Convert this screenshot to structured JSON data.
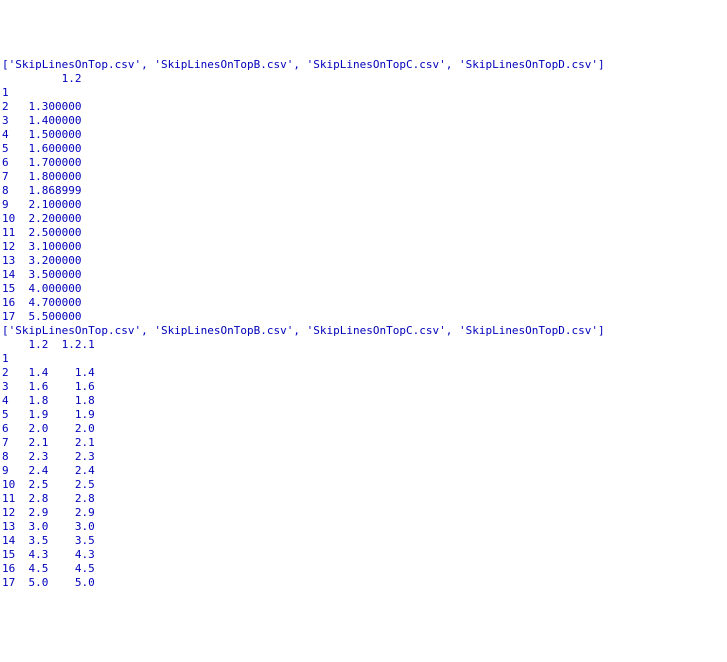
{
  "blocks": [
    {
      "file_list": "['SkipLinesOnTop.csv', 'SkipLinesOnTopB.csv', 'SkipLinesOnTopC.csv', 'SkipLinesOnTopD.csv']",
      "header": "         1.2",
      "index_only_first": "1",
      "rows": [
        {
          "i": "2",
          "cells": [
            "1.300000"
          ]
        },
        {
          "i": "3",
          "cells": [
            "1.400000"
          ]
        },
        {
          "i": "4",
          "cells": [
            "1.500000"
          ]
        },
        {
          "i": "5",
          "cells": [
            "1.600000"
          ]
        },
        {
          "i": "6",
          "cells": [
            "1.700000"
          ]
        },
        {
          "i": "7",
          "cells": [
            "1.800000"
          ]
        },
        {
          "i": "8",
          "cells": [
            "1.868999"
          ]
        },
        {
          "i": "9",
          "cells": [
            "2.100000"
          ]
        },
        {
          "i": "10",
          "cells": [
            "2.200000"
          ]
        },
        {
          "i": "11",
          "cells": [
            "2.500000"
          ]
        },
        {
          "i": "12",
          "cells": [
            "3.100000"
          ]
        },
        {
          "i": "13",
          "cells": [
            "3.200000"
          ]
        },
        {
          "i": "14",
          "cells": [
            "3.500000"
          ]
        },
        {
          "i": "15",
          "cells": [
            "4.000000"
          ]
        },
        {
          "i": "16",
          "cells": [
            "4.700000"
          ]
        },
        {
          "i": "17",
          "cells": [
            "5.500000"
          ]
        }
      ]
    },
    {
      "file_list": "['SkipLinesOnTop.csv', 'SkipLinesOnTopB.csv', 'SkipLinesOnTopC.csv', 'SkipLinesOnTopD.csv']",
      "header": "    1.2  1.2.1",
      "index_only_first": "1",
      "rows": [
        {
          "i": "2",
          "cells": [
            "1.4",
            "1.4"
          ]
        },
        {
          "i": "3",
          "cells": [
            "1.6",
            "1.6"
          ]
        },
        {
          "i": "4",
          "cells": [
            "1.8",
            "1.8"
          ]
        },
        {
          "i": "5",
          "cells": [
            "1.9",
            "1.9"
          ]
        },
        {
          "i": "6",
          "cells": [
            "2.0",
            "2.0"
          ]
        },
        {
          "i": "7",
          "cells": [
            "2.1",
            "2.1"
          ]
        },
        {
          "i": "8",
          "cells": [
            "2.3",
            "2.3"
          ]
        },
        {
          "i": "9",
          "cells": [
            "2.4",
            "2.4"
          ]
        },
        {
          "i": "10",
          "cells": [
            "2.5",
            "2.5"
          ]
        },
        {
          "i": "11",
          "cells": [
            "2.8",
            "2.8"
          ]
        },
        {
          "i": "12",
          "cells": [
            "2.9",
            "2.9"
          ]
        },
        {
          "i": "13",
          "cells": [
            "3.0",
            "3.0"
          ]
        },
        {
          "i": "14",
          "cells": [
            "3.5",
            "3.5"
          ]
        },
        {
          "i": "15",
          "cells": [
            "4.3",
            "4.3"
          ]
        },
        {
          "i": "16",
          "cells": [
            "4.5",
            "4.5"
          ]
        },
        {
          "i": "17",
          "cells": [
            "5.0",
            "5.0"
          ]
        }
      ]
    }
  ]
}
